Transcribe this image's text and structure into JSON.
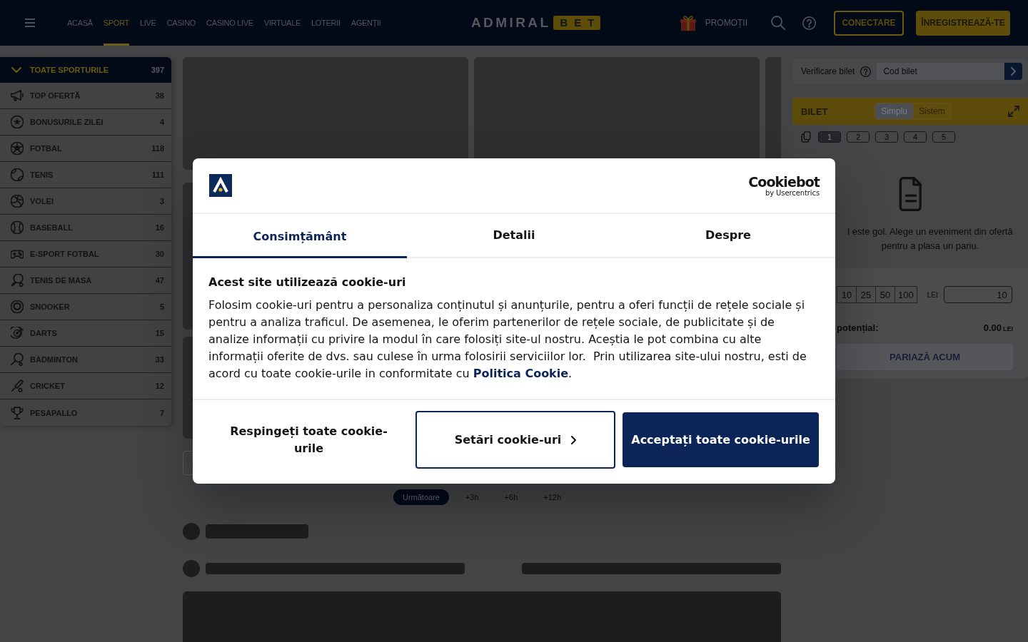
{
  "header": {
    "nav": [
      {
        "label": "ACASĂ",
        "selected": false
      },
      {
        "label": "SPORT",
        "selected": true
      },
      {
        "label": "LIVE",
        "selected": false
      },
      {
        "label": "CASINO",
        "selected": false
      },
      {
        "label": "CASINO LIVE",
        "selected": false
      },
      {
        "label": "VIRTUALE",
        "selected": false
      },
      {
        "label": "LOTERII",
        "selected": false
      },
      {
        "label": "AGENȚII",
        "selected": false
      }
    ],
    "logo": {
      "word": "ADMIRAL",
      "suffix": "BET"
    },
    "promo": "PROMOȚII",
    "buttons": [
      {
        "label": "CONECTARE",
        "kind": "outline"
      },
      {
        "label": "ÎNREGISTREAZĂ-TE",
        "kind": "filled"
      }
    ]
  },
  "sidebar": {
    "header": {
      "label": "TOATE SPORTURILE",
      "count": "397",
      "expanded": true
    },
    "items": [
      {
        "label": "TOP OFERTĂ",
        "count": "38",
        "kind": "megaphone"
      },
      {
        "label": "BONUSURILE ZILEI",
        "count": "4",
        "kind": "star"
      },
      {
        "label": "FOTBAL",
        "count": "118",
        "kind": "soccer"
      },
      {
        "label": "TENIS",
        "count": "111",
        "kind": "tennis"
      },
      {
        "label": "VOLEI",
        "count": "3",
        "kind": "volleyball"
      },
      {
        "label": "BASEBALL",
        "count": "16",
        "kind": "baseball"
      },
      {
        "label": "E-SPORT FOTBAL",
        "count": "30",
        "kind": "gamepad"
      },
      {
        "label": "TENIS DE MASA",
        "count": "47",
        "kind": "tabletennis"
      },
      {
        "label": "SNOOKER",
        "count": "5",
        "kind": "snooker"
      },
      {
        "label": "DARTS",
        "count": "15",
        "kind": "darts"
      },
      {
        "label": "BADMINTON",
        "count": "33",
        "kind": "badminton"
      },
      {
        "label": "CRICKET",
        "count": "12",
        "kind": "cricket"
      },
      {
        "label": "PESAPALLO",
        "count": "7",
        "kind": "trophy"
      }
    ]
  },
  "main": {
    "time_filters": [
      {
        "label": "Următoare",
        "selected": true
      },
      {
        "label": "+3h",
        "selected": false
      },
      {
        "label": "+6h",
        "selected": false
      },
      {
        "label": "+12h",
        "selected": false
      }
    ]
  },
  "betslip": {
    "check": {
      "label": "Verificare bilet",
      "placeholder": "Cod bilet"
    },
    "title": "BILET",
    "modes": [
      {
        "label": "Simplu",
        "selected": true
      },
      {
        "label": "Sistem",
        "selected": false
      }
    ],
    "slots": [
      {
        "label": "1",
        "selected": true
      },
      {
        "label": "2",
        "selected": false
      },
      {
        "label": "3",
        "selected": false
      },
      {
        "label": "4",
        "selected": false
      },
      {
        "label": "5",
        "selected": false
      }
    ],
    "empty_message": "l este gol. Alege un eveniment din ofertă pentru a plasa un pariu.",
    "stakes": [
      "10",
      "25",
      "50",
      "100"
    ],
    "currency": "LEI",
    "stake_value": "10",
    "potential_label": "potențial:",
    "potential_value": "0.00",
    "potential_currency": "LEI",
    "submit": "PARIAZĂ ACUM"
  },
  "cookie_dialog": {
    "brand": {
      "name": "Cookiebot",
      "byline": "by Usercentrics"
    },
    "tabs": [
      {
        "label": "Consimțământ",
        "selected": true
      },
      {
        "label": "Detalii",
        "selected": false
      },
      {
        "label": "Despre",
        "selected": false
      }
    ],
    "title": "Acest site utilizează cookie-uri",
    "body": "Folosim cookie-uri pentru a personaliza conținutul și anunțurile, pentru a oferi funcții de rețele sociale și pentru a analiza traficul. De asemenea, le oferim partenerilor de rețele sociale, de publicitate și de analize informații cu privire la modul în care folosiți site-ul nostru. Aceștia le pot combina cu alte informații oferite de dvs. sau culese în urma folosirii serviciilor lor.  Prin utilizarea site-ului nostru, esti de acord cu toate cookie-urile in conformitate cu ",
    "link": "Politica Cookie",
    "after": ".",
    "buttons": [
      {
        "label": "Respingeți toate cookie-urile",
        "kind": "plain"
      },
      {
        "label": "Setări cookie-uri",
        "kind": "outline"
      },
      {
        "label": "Acceptați toate cookie-urile",
        "kind": "filled"
      }
    ]
  }
}
